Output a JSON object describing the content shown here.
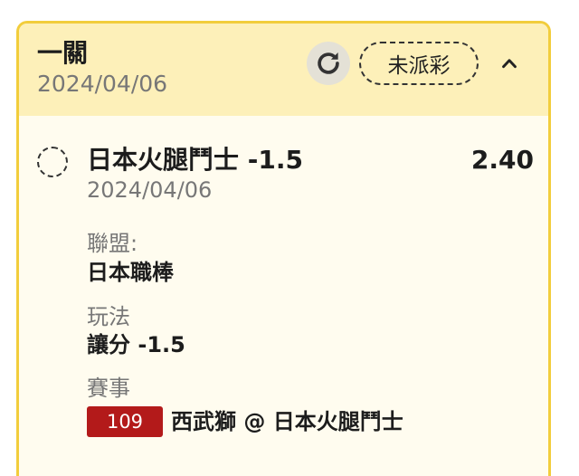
{
  "ticket": {
    "title": "一關",
    "date": "2024/04/06",
    "status": "未派彩",
    "refresh_icon": "refresh-icon",
    "collapse_icon": "chevron-up-icon"
  },
  "selection": {
    "name": "日本火腿鬥士 -1.5",
    "odds": "2.40",
    "date": "2024/04/06",
    "league_label": "聯盟:",
    "league_value": "日本職棒",
    "market_label": "玩法",
    "market_value": "讓分 -1.5",
    "event_label": "賽事",
    "event_code": "109",
    "event_name": "西武獅 @ 日本火腿鬥士"
  },
  "colors": {
    "card_border": "#f2cd3c",
    "header_bg": "#fdf0b9",
    "body_bg": "#fffcef",
    "badge_bg": "#b31a1a"
  }
}
